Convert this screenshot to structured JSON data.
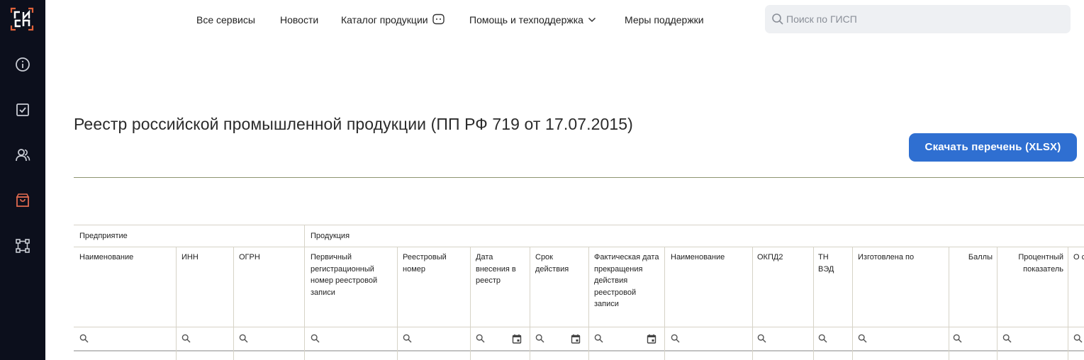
{
  "app": {
    "logo_text": "ГИСП"
  },
  "sidebar": {
    "items": [
      {
        "name": "info",
        "icon": "info-icon"
      },
      {
        "name": "checklist",
        "icon": "checkbox-icon"
      },
      {
        "name": "users",
        "icon": "users-icon"
      },
      {
        "name": "catalog",
        "icon": "shopping-bag-icon",
        "active": true
      },
      {
        "name": "workflow",
        "icon": "workflow-icon"
      }
    ]
  },
  "nav": {
    "all_services": "Все сервисы",
    "news": "Новости",
    "catalog": "Каталог продукции",
    "help": "Помощь и техподдержка",
    "support": "Меры поддержки"
  },
  "search": {
    "placeholder": "Поиск по ГИСП"
  },
  "page": {
    "title": "Реестр российской промышленной продукции (ПП РФ 719 от 17.07.2015)",
    "download_label": "Скачать перечень (XLSX)"
  },
  "table": {
    "groups": [
      "Предприятие",
      "Продукция"
    ],
    "columns": [
      "Наименование",
      "ИНН",
      "ОГРН",
      "Первичный регистрационный номер реестровой записи",
      "Реестровый номер",
      "Дата внесения в реестр",
      "Срок действия",
      "Фактическая дата прекращения действия реестровой записи",
      "Наименование",
      "ОКПД2",
      "ТН ВЭД",
      "Изготовлена по",
      "Баллы",
      "Процентный показатель",
      "О с"
    ]
  },
  "colors": {
    "sidebar_bg": "#0c0f1c",
    "accent": "#2f6fd1",
    "logo_accent": "#e0623a",
    "active_icon": "#e06a4f"
  }
}
